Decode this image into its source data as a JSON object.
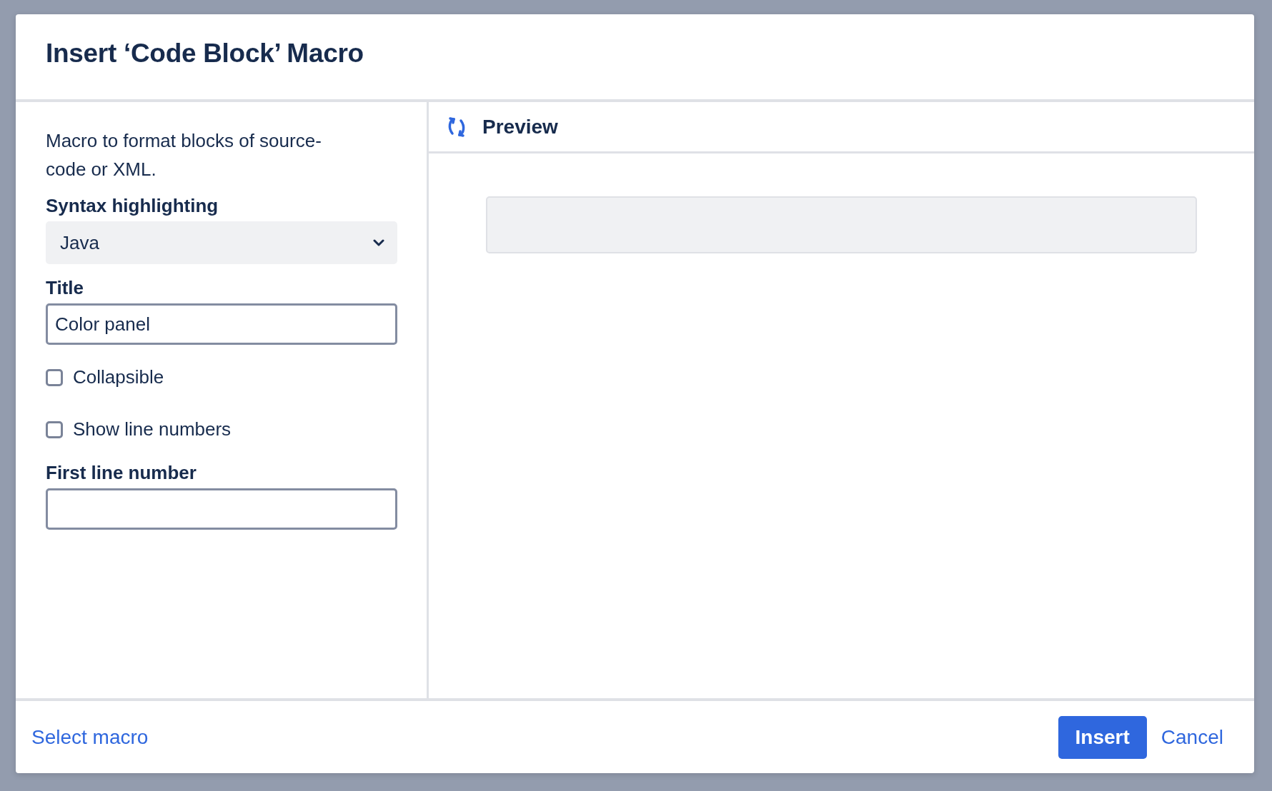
{
  "dialog": {
    "title": "Insert ‘Code Block’ Macro"
  },
  "description": "Macro to format blocks of source-code or XML.",
  "fields": [
    {
      "kind": "select",
      "label": "Syntax highlighting",
      "value": "Java"
    },
    {
      "kind": "text",
      "label": "Title",
      "value": "Color panel"
    },
    {
      "kind": "checkbox",
      "label": "Collapsible",
      "checked": false
    },
    {
      "kind": "checkbox",
      "label": "Show line numbers",
      "checked": false
    },
    {
      "kind": "text",
      "label": "First line number"
    }
  ],
  "preview": {
    "title": "Preview"
  },
  "footer": {
    "link": "Select macro",
    "buttons": [
      {
        "kind": "primary",
        "label": "Insert"
      },
      {
        "kind": "link",
        "label": "Cancel"
      }
    ]
  }
}
